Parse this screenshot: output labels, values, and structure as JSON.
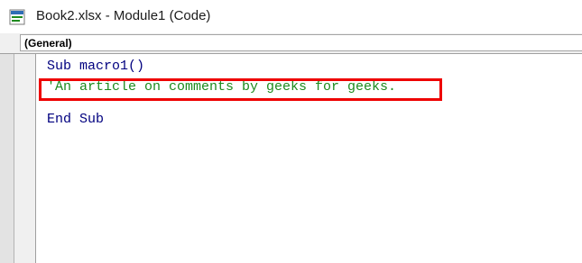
{
  "window": {
    "title": "Book2.xlsx - Module1 (Code)",
    "icon": "excel-vba-icon"
  },
  "object_selector": {
    "value": "(General)"
  },
  "code": {
    "lines": [
      {
        "text": "Sub macro1()",
        "kind": "keyword"
      },
      {
        "text": "'An article on comments by geeks for geeks.",
        "kind": "comment"
      },
      {
        "text": "",
        "kind": "blank"
      },
      {
        "text": "End Sub",
        "kind": "keyword"
      }
    ]
  },
  "colors": {
    "keyword": "#00007f",
    "comment": "#1d8a1d",
    "highlight": "#ee0000"
  }
}
